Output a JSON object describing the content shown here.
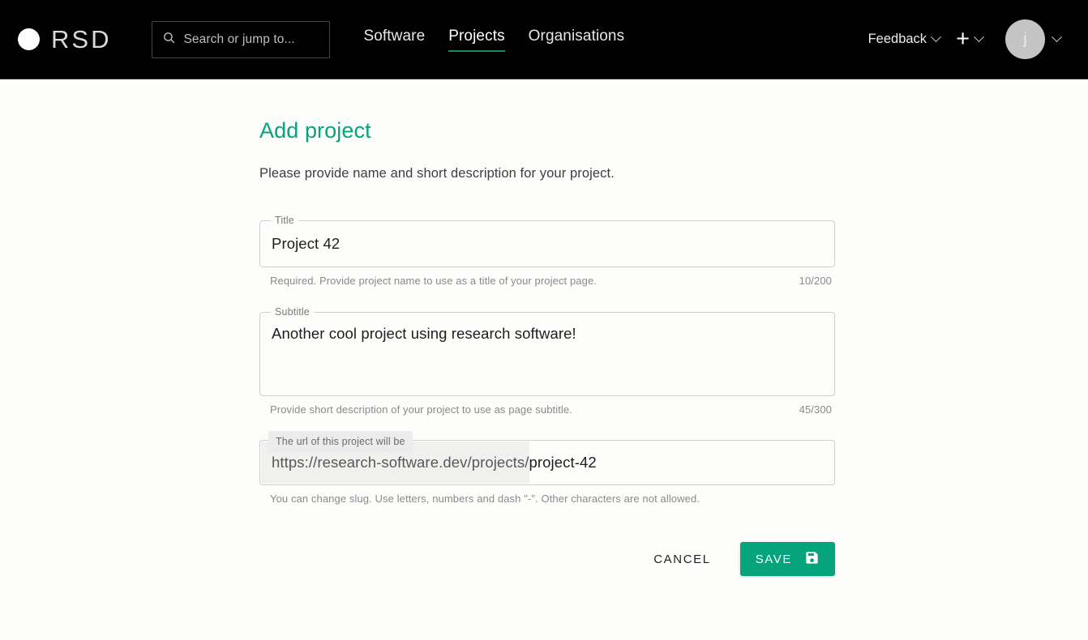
{
  "header": {
    "brand": {
      "logo_icon": "circle-logo",
      "name": "RSD"
    },
    "search": {
      "icon": "search-icon",
      "placeholder": "Search or jump to..."
    },
    "nav": [
      {
        "label": "Software",
        "active": false
      },
      {
        "label": "Projects",
        "active": true
      },
      {
        "label": "Organisations",
        "active": false
      }
    ],
    "feedback": {
      "label": "Feedback",
      "icon": "chevron-down-icon"
    },
    "add": {
      "icon": "plus-icon",
      "chevron": "chevron-down-icon"
    },
    "account": {
      "initial": "j",
      "chevron": "chevron-down-icon"
    },
    "accent_color": "#128a5e",
    "background_color": "#000000"
  },
  "main": {
    "title": "Add project",
    "title_color": "#06a47a",
    "description": "Please provide name and short description for your project.",
    "form": {
      "title_field": {
        "label": "Title",
        "value": "Project 42",
        "helper": "Required. Provide project name to use as a title of your project page.",
        "counter": "10/200"
      },
      "subtitle_field": {
        "label": "Subtitle",
        "value": "Another cool project using research software!",
        "helper": "Provide short description of your project to use as page subtitle.",
        "counter": "45/300"
      },
      "slug_field": {
        "label": "The url of this project will be",
        "prefix": "https://research-software.dev/projects/",
        "value": "project-42",
        "helper": "You can change slug. Use letters, numbers and dash \"-\". Other characters are not allowed."
      }
    },
    "actions": {
      "cancel_label": "CANCEL",
      "save_label": "SAVE",
      "save_icon": "save-floppy-icon",
      "save_color": "#06a47a"
    }
  }
}
